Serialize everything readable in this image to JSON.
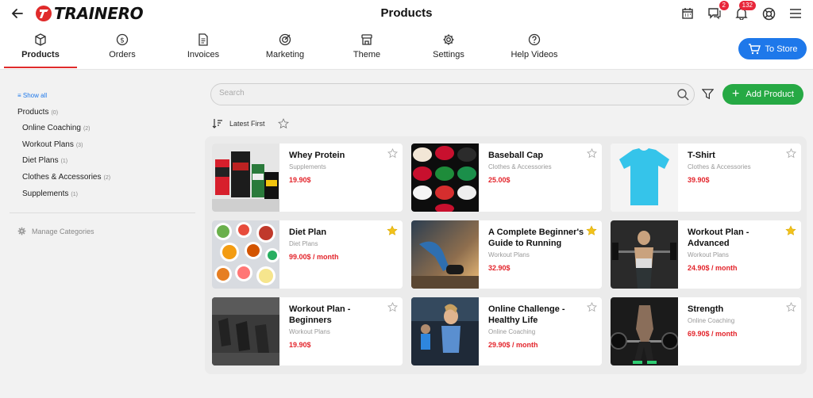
{
  "header": {
    "logo_text": "TRAINERO",
    "page_title": "Products",
    "messages_badge": "2",
    "notifications_badge": "132",
    "icons": [
      "calendar-icon",
      "chat-icon",
      "bell-icon",
      "lifebuoy-icon",
      "menu-icon"
    ]
  },
  "tabs": [
    {
      "label": "Products",
      "icon": "box-icon",
      "active": true
    },
    {
      "label": "Orders",
      "icon": "dollar-icon"
    },
    {
      "label": "Invoices",
      "icon": "document-icon"
    },
    {
      "label": "Marketing",
      "icon": "target-icon"
    },
    {
      "label": "Theme",
      "icon": "store-icon"
    },
    {
      "label": "Settings",
      "icon": "gear-icon"
    },
    {
      "label": "Help Videos",
      "icon": "question-icon"
    }
  ],
  "store_button": "To Store",
  "sidebar": {
    "show_all": "Show all",
    "root": {
      "label": "Products",
      "count": "(0)"
    },
    "categories": [
      {
        "label": "Online Coaching",
        "count": "(2)"
      },
      {
        "label": "Workout Plans",
        "count": "(3)"
      },
      {
        "label": "Diet Plans",
        "count": "(1)"
      },
      {
        "label": "Clothes & Accessories",
        "count": "(2)"
      },
      {
        "label": "Supplements",
        "count": "(1)"
      }
    ],
    "manage": "Manage Categories"
  },
  "search": {
    "placeholder": "Search"
  },
  "add_button": "Add Product",
  "sort": {
    "label": "Latest First"
  },
  "colors": {
    "accent": "#1e78ea",
    "add": "#26a944",
    "price": "#e3242b",
    "brand": "#e02b2b",
    "star": "#f2c21b"
  },
  "products": [
    {
      "name": "Whey Protein",
      "category": "Supplements",
      "price": "19.90$",
      "starred": false
    },
    {
      "name": "Baseball Cap",
      "category": "Clothes & Accessories",
      "price": "25.00$",
      "starred": false
    },
    {
      "name": "T-Shirt",
      "category": "Clothes & Accessories",
      "price": "39.90$",
      "starred": false
    },
    {
      "name": "Diet Plan",
      "category": "Diet Plans",
      "price": "99.00$ / month",
      "starred": true
    },
    {
      "name": "A Complete Beginner's Guide to Running",
      "category": "Workout Plans",
      "price": "32.90$",
      "starred": true
    },
    {
      "name": "Workout Plan - Advanced",
      "category": "Workout Plans",
      "price": "24.90$ / month",
      "starred": true
    },
    {
      "name": "Workout Plan - Beginners",
      "category": "Workout Plans",
      "price": "19.90$",
      "starred": false
    },
    {
      "name": "Online Challenge - Healthy Life",
      "category": "Online Coaching",
      "price": "29.90$ / month",
      "starred": false
    },
    {
      "name": "Strength",
      "category": "Online Coaching",
      "price": "69.90$ / month",
      "starred": false
    }
  ]
}
